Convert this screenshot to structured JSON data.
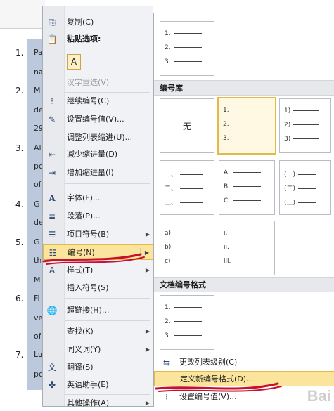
{
  "document": {
    "numbers": [
      "1.",
      "2.",
      "3.",
      "4.",
      "5.",
      "6.",
      "7."
    ],
    "fragments": [
      "Pa",
      "na",
      "M",
      "de",
      "29",
      "Al",
      "pc",
      "of",
      "G",
      "de",
      "G",
      "th",
      "M",
      "Fi",
      "ve",
      "of",
      "Lu",
      "pc"
    ]
  },
  "context_menu": {
    "items": [
      {
        "label": "复制(C)",
        "icon": "copy-icon",
        "dim": false
      },
      {
        "label": "汉字重选(V)",
        "icon": "",
        "dim": true
      },
      {
        "label": "继续编号(C)",
        "icon": "continue-numbering-icon",
        "dim": false
      },
      {
        "label": "设置编号值(V)...",
        "icon": "set-value-icon",
        "dim": false
      },
      {
        "label": "调整列表缩进(U)...",
        "icon": "",
        "dim": false
      },
      {
        "label": "减少缩进量(D)",
        "icon": "decrease-indent-icon",
        "dim": false
      },
      {
        "label": "增加缩进量(I)",
        "icon": "increase-indent-icon",
        "dim": false
      },
      {
        "label": "字体(F)...",
        "icon": "font-icon",
        "dim": false
      },
      {
        "label": "段落(P)...",
        "icon": "paragraph-icon",
        "dim": false
      },
      {
        "label": "项目符号(B)",
        "icon": "bullets-icon",
        "dim": false
      },
      {
        "label": "编号(N)",
        "icon": "numbering-icon",
        "dim": false
      },
      {
        "label": "样式(T)",
        "icon": "styles-icon",
        "dim": false
      },
      {
        "label": "插入符号(S)",
        "icon": "",
        "dim": false
      },
      {
        "label": "超链接(H)...",
        "icon": "hyperlink-icon",
        "dim": false
      },
      {
        "label": "查找(K)",
        "icon": "",
        "dim": false
      },
      {
        "label": "同义词(Y)",
        "icon": "",
        "dim": false
      },
      {
        "label": "翻译(S)",
        "icon": "translate-icon",
        "dim": false
      },
      {
        "label": "英语助手(E)",
        "icon": "english-assistant-icon",
        "dim": false
      },
      {
        "label": "其他操作(A)",
        "icon": "",
        "dim": false
      }
    ],
    "paste_header": "粘贴选项:"
  },
  "numbering_submenu": {
    "recent_rows": [
      "1.",
      "2.",
      "3."
    ],
    "library_header": "编号库",
    "none_label": "无",
    "tile_decimal": [
      "1.",
      "2.",
      "3."
    ],
    "tile_paren": [
      "1)",
      "2)",
      "3)"
    ],
    "tile_chinese": [
      "一、",
      "二、",
      "三、"
    ],
    "tile_letters": [
      "A.",
      "B.",
      "C."
    ],
    "tile_chinese_paren": [
      "(一)",
      "(二)",
      "(三)"
    ],
    "tile_lower_alpha": [
      "a)",
      "b)",
      "c)"
    ],
    "tile_roman": [
      "i.",
      "ii.",
      "iii."
    ],
    "doc_formats_header": "文档编号格式",
    "doc_rows": [
      "1.",
      "2.",
      "3."
    ],
    "change_level": "更改列表级别(C)",
    "define_new": "定义新编号格式(D)...",
    "set_value": "设置编号值(V)..."
  },
  "watermark": "Bai",
  "colors": {
    "highlight": "#fbe49b",
    "highlight_border": "#e0b94a",
    "selection": "#bcc8dc",
    "scribble": "#c8102e"
  }
}
